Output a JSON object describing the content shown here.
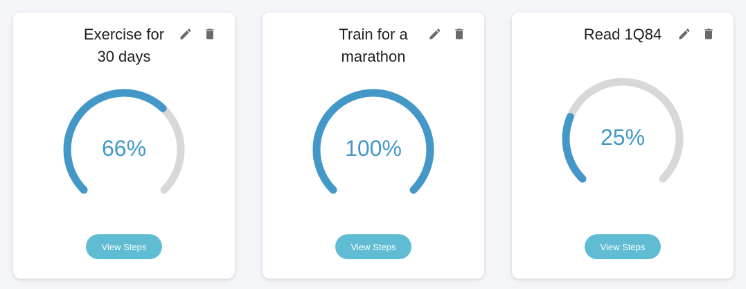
{
  "accent_color": "#4398c8",
  "track_color": "#d8d8d8",
  "button_color": "#5fbcd3",
  "goals": [
    {
      "title_lines": [
        "Exercise for",
        "30 days"
      ],
      "progress_label": "66%",
      "progress": 0.66,
      "edit_icon": "pencil-icon",
      "delete_icon": "trash-icon",
      "button_label": "View Steps"
    },
    {
      "title_lines": [
        "Train for a",
        "marathon"
      ],
      "progress_label": "100%",
      "progress": 1.0,
      "edit_icon": "pencil-icon",
      "delete_icon": "trash-icon",
      "button_label": "View Steps"
    },
    {
      "title_lines": [
        "Read 1Q84",
        ""
      ],
      "progress_label": "25%",
      "progress": 0.25,
      "edit_icon": "pencil-icon",
      "delete_icon": "trash-icon",
      "button_label": "View Steps"
    }
  ]
}
